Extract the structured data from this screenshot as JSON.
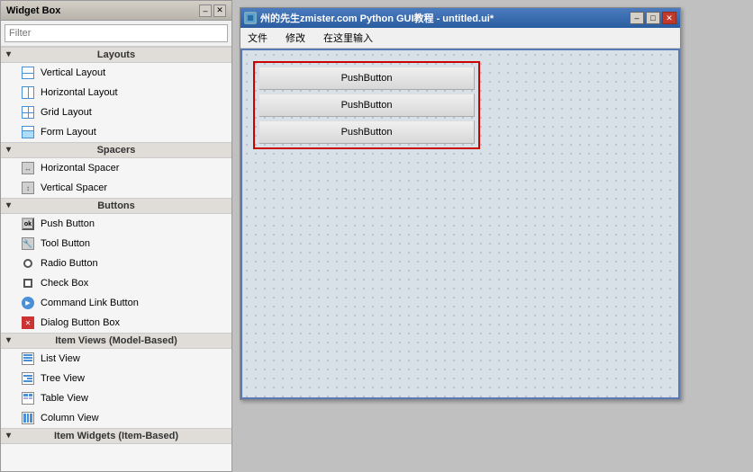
{
  "widgetbox": {
    "title": "Widget Box",
    "filter_placeholder": "Filter",
    "titlebar_buttons": {
      "minimize": "–",
      "close": "✕"
    }
  },
  "categories": {
    "layouts": {
      "label": "Layouts",
      "items": [
        {
          "label": "Vertical Layout",
          "icon": "vertical-layout-icon"
        },
        {
          "label": "Horizontal Layout",
          "icon": "horizontal-layout-icon"
        },
        {
          "label": "Grid Layout",
          "icon": "grid-layout-icon"
        },
        {
          "label": "Form Layout",
          "icon": "form-layout-icon"
        }
      ]
    },
    "spacers": {
      "label": "Spacers",
      "items": [
        {
          "label": "Horizontal Spacer",
          "icon": "horizontal-spacer-icon"
        },
        {
          "label": "Vertical Spacer",
          "icon": "vertical-spacer-icon"
        }
      ]
    },
    "buttons": {
      "label": "Buttons",
      "items": [
        {
          "label": "Push Button",
          "icon": "push-button-icon"
        },
        {
          "label": "Tool Button",
          "icon": "tool-button-icon"
        },
        {
          "label": "Radio Button",
          "icon": "radio-button-icon"
        },
        {
          "label": "Check Box",
          "icon": "check-box-icon"
        },
        {
          "label": "Command Link Button",
          "icon": "command-link-button-icon"
        },
        {
          "label": "Dialog Button Box",
          "icon": "dialog-button-box-icon"
        }
      ]
    },
    "item_views": {
      "label": "Item Views (Model-Based)",
      "items": [
        {
          "label": "List View",
          "icon": "list-view-icon"
        },
        {
          "label": "Tree View",
          "icon": "tree-view-icon"
        },
        {
          "label": "Table View",
          "icon": "table-view-icon"
        },
        {
          "label": "Column View",
          "icon": "column-view-icon"
        }
      ]
    },
    "item_widgets": {
      "label": "Item Widgets (Item-Based)"
    }
  },
  "designer": {
    "title": "州的先生zmister.com Python GUI教程 - untitled.ui*",
    "menu": {
      "file": "文件",
      "edit": "修改",
      "here": "在这里输入"
    },
    "buttons": [
      {
        "label": "PushButton"
      },
      {
        "label": "PushButton"
      },
      {
        "label": "PushButton"
      }
    ]
  }
}
